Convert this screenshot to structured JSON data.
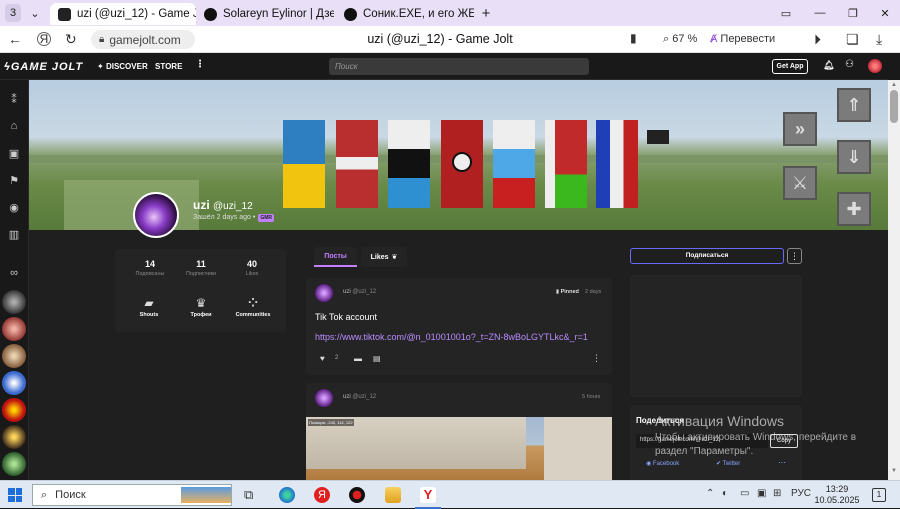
{
  "browser": {
    "tab_count": "3",
    "tabs": [
      {
        "label": "uzi (@uzi_12) - Game Jolt"
      },
      {
        "label": "Solareyn Eylinor | Дзен"
      },
      {
        "label": "Соник.EXE, и его ЖЕРТВЫ"
      }
    ],
    "url": "gamejolt.com",
    "page_title": "uzi (@uzi_12) - Game Jolt",
    "zoom": "67 %",
    "translate_label": "Перевести"
  },
  "gamejolt": {
    "logo": "GAME JOLT",
    "nav": {
      "discover": "DISCOVER",
      "store": "STORE"
    },
    "search_placeholder": "Поиск",
    "get_app": "Get App"
  },
  "profile": {
    "display_name": "uzi",
    "handle": "@uzi_12",
    "status": "Зашёл 2 days ago",
    "badge": "GMR",
    "stats": [
      {
        "value": "14",
        "label": "Подписаны"
      },
      {
        "value": "11",
        "label": "Подписчики"
      },
      {
        "value": "40",
        "label": "Likes"
      }
    ],
    "subnav": [
      {
        "label": "Shouts",
        "icon": "speech-bubble-icon"
      },
      {
        "label": "Трофеи",
        "icon": "trophy-icon"
      },
      {
        "label": "Communities",
        "icon": "grid-icon"
      }
    ],
    "follow_label": "Подписаться"
  },
  "feed": {
    "tabs": [
      {
        "label": "Посты"
      },
      {
        "label": "Likes"
      }
    ],
    "posts": [
      {
        "author": "uzi",
        "handle": "@uzi_12",
        "pinned_label": "Pinned",
        "time": "2 days",
        "text": "Tik Tok account",
        "link": "https://www.tiktok.com/@n_01001001o?_t=ZN-8wBoLGYTLkc&_r=1",
        "likes": "2"
      },
      {
        "author": "uzi",
        "handle": "@uzi_12",
        "time": "5 hours",
        "image_overlay": "Позиция: -240, 114, 122"
      }
    ]
  },
  "share": {
    "title": "Поделиться",
    "url": "https://gamejolt.com/@uzi_12",
    "copy_label": "Copy",
    "facebook": "Facebook",
    "twitter": "Twitter"
  },
  "watermark": {
    "title": "Активация Windows",
    "line1": "Чтобы активировать Windows, перейдите в",
    "line2": "раздел \"Параметры\"."
  },
  "taskbar": {
    "search_label": "Поиск",
    "lang": "РУС",
    "time": "13:29",
    "date": "10.05.2025",
    "notifications": "1"
  },
  "colors": {
    "accent_purple": "#c080ff",
    "link_purple": "#b98cff",
    "gj_bg": "#191919",
    "card_bg": "#242424",
    "browser_tabstrip": "#e9e0f7"
  }
}
